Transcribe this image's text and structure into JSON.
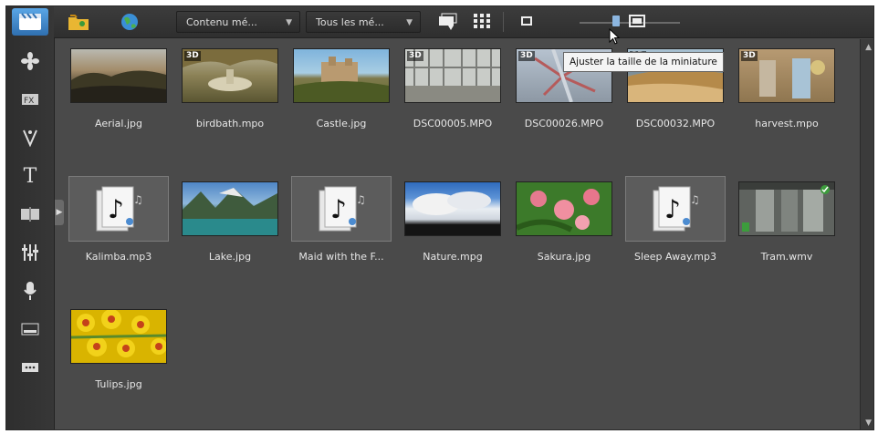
{
  "toolbar": {
    "content_filter": "Contenu mé...",
    "media_filter": "Tous les mé...",
    "tooltip": "Ajuster la taille de la miniature",
    "thumbnail_size_level": 0.35
  },
  "sidebar": {
    "items": [
      {
        "name": "media-library"
      },
      {
        "name": "transitions"
      },
      {
        "name": "video-effects"
      },
      {
        "name": "particles"
      },
      {
        "name": "titles"
      },
      {
        "name": "chapters"
      },
      {
        "name": "audio-mixer"
      },
      {
        "name": "voice-over"
      },
      {
        "name": "subtitles"
      },
      {
        "name": "more"
      }
    ]
  },
  "library": {
    "items": [
      {
        "label": "Aerial.jpg",
        "kind": "photo",
        "badge": ""
      },
      {
        "label": "birdbath.mpo",
        "kind": "photo",
        "badge": "3D"
      },
      {
        "label": "Castle.jpg",
        "kind": "photo",
        "badge": ""
      },
      {
        "label": "DSC00005.MPO",
        "kind": "photo",
        "badge": "3D"
      },
      {
        "label": "DSC00026.MPO",
        "kind": "photo",
        "badge": "3D"
      },
      {
        "label": "DSC00032.MPO",
        "kind": "photo",
        "badge": "3D"
      },
      {
        "label": "harvest.mpo",
        "kind": "photo",
        "badge": "3D"
      },
      {
        "label": "Kalimba.mp3",
        "kind": "audio",
        "badge": ""
      },
      {
        "label": "Lake.jpg",
        "kind": "photo",
        "badge": ""
      },
      {
        "label": "Maid with the F...",
        "kind": "audio",
        "badge": ""
      },
      {
        "label": "Nature.mpg",
        "kind": "video",
        "badge": ""
      },
      {
        "label": "Sakura.jpg",
        "kind": "photo",
        "badge": ""
      },
      {
        "label": "Sleep Away.mp3",
        "kind": "audio",
        "badge": ""
      },
      {
        "label": "Tram.wmv",
        "kind": "video",
        "badge": ""
      },
      {
        "label": "Tulips.jpg",
        "kind": "photo",
        "badge": ""
      }
    ]
  }
}
